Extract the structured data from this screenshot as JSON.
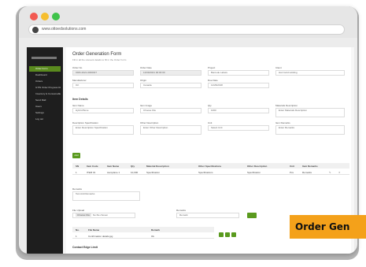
{
  "browser": {
    "url": "www.ottoedsolutions.com"
  },
  "sidebar": {
    "items": [
      {
        "label": "Order Form"
      },
      {
        "label": "Dashboard"
      },
      {
        "label": "Orders"
      },
      {
        "label": "GTIN Order Progress Report"
      },
      {
        "label": "Inventory & Consumables"
      },
      {
        "label": "Send Mail"
      },
      {
        "label": "Users"
      },
      {
        "label": "Settings"
      },
      {
        "label": "Log out"
      }
    ]
  },
  "form": {
    "title": "Order Generation Form",
    "subtitle": "Fill in all the relevant details to fill in the Order Form",
    "fields": {
      "order_no": {
        "label": "Order No",
        "value": "ORD-2021-0000027"
      },
      "order_date": {
        "label": "Order Date",
        "value": "12/09/2021 00:00:00"
      },
      "project": {
        "label": "Project",
        "value": "Barcode Labels"
      },
      "client": {
        "label": "Client",
        "value": "Hari Gold Holding"
      },
      "manufacturer": {
        "label": "Manufacturer",
        "value": "Ort"
      },
      "origin": {
        "label": "Origin",
        "value": "Canada"
      },
      "due_date": {
        "label": "Due Date",
        "value": "11/29/2018"
      }
    },
    "item_section": "Item Details",
    "item_fields": {
      "item_name": {
        "label": "Item Name",
        "value": "Hybrid Bone"
      },
      "item_image": {
        "label": "Item Image",
        "value": "Choose File"
      },
      "qty": {
        "label": "Qty",
        "value": "1000"
      },
      "description": {
        "label": "Materials Description",
        "value": "Enter Materials Description"
      },
      "size": {
        "label": "Description Specification",
        "value": "Enter Description Specification"
      },
      "other": {
        "label": "Other Description",
        "value": "Enter Other Description"
      },
      "unit": {
        "label": "Unit",
        "value": "Select Unit"
      },
      "item_remarks": {
        "label": "Item Remarks",
        "value": "Enter Remarks"
      }
    },
    "add_label": "Add"
  },
  "table": {
    "headers": [
      "SN",
      "Item Code",
      "Item Name",
      "Qty",
      "Material Description",
      "Other Specifications",
      "Other Description",
      "Unit",
      "Item Remarks"
    ],
    "rows": [
      [
        "1",
        "ITEM 01",
        "Aeroplane 1",
        "10,000",
        "Specification",
        "Specifications",
        "Specification",
        "Pcs",
        "Remarks"
      ]
    ]
  },
  "remarks": {
    "label": "Remarks",
    "value": "Test Add Remarks"
  },
  "attachments": {
    "file_label": "File Upload",
    "file_button": "Choose File",
    "file_status": "No file chosen",
    "remarks_label": "Remarks",
    "remarks_placeholder": "Remark"
  },
  "table2": {
    "headers": [
      "No.",
      "File Name",
      "Remark"
    ],
    "rows": [
      [
        "1",
        "Confirmation details.jpg",
        "Ok"
      ]
    ]
  },
  "footer_section": "Contact Edge Limit",
  "callout": "Order Gen"
}
